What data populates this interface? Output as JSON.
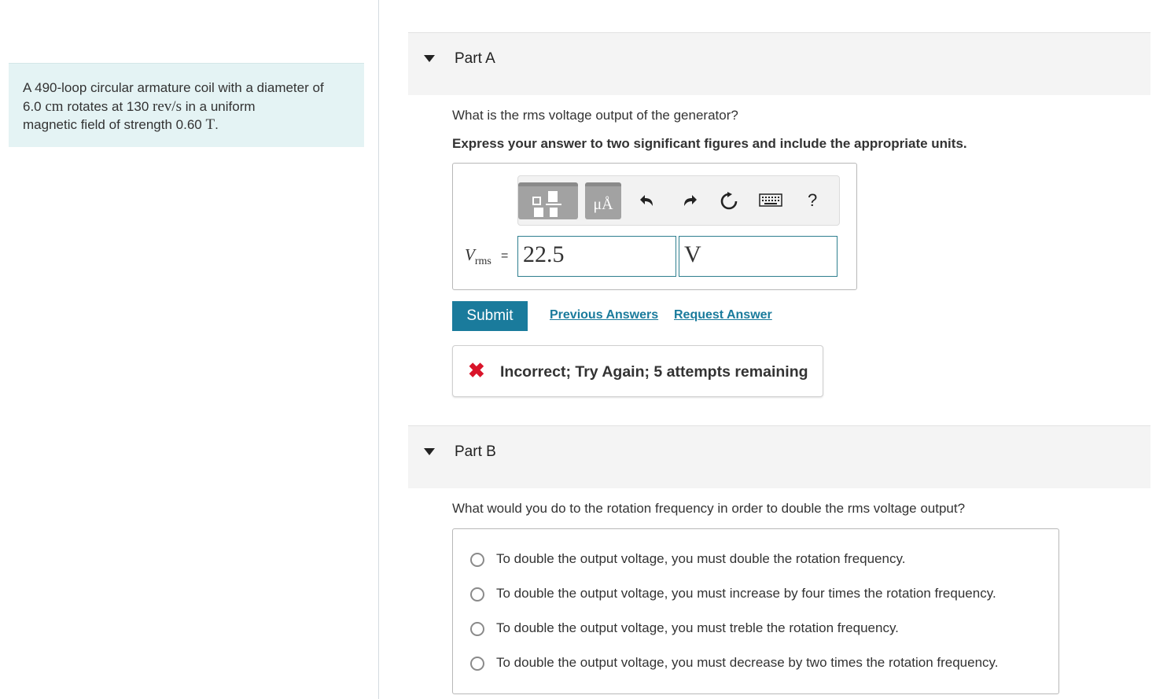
{
  "problem": {
    "text_1": "A 490-loop circular armature coil with a diameter of",
    "value_1": "6.0",
    "unit_1": "cm",
    "text_2": "rotates at 130",
    "unit_2": "rev/s",
    "text_3": "in a uniform",
    "text_4": "magnetic field of strength 0.60",
    "unit_3": "T",
    "text_5": "."
  },
  "part_a": {
    "title": "Part A",
    "question": "What is the rms voltage output of the generator?",
    "instruction": "Express your answer to two significant figures and include the appropriate units.",
    "toolbar": {
      "units_button_label": "μÅ",
      "help_label": "?",
      "icons": [
        "templates-icon",
        "units-icon",
        "undo-icon",
        "redo-icon",
        "reset-icon",
        "keyboard-icon",
        "help-icon"
      ]
    },
    "variable": "V",
    "variable_sub": "rms",
    "equals": "=",
    "value_input": "22.5",
    "units_input": "V",
    "submit_label": "Submit",
    "previous_answers_label": "Previous Answers",
    "request_answer_label": "Request Answer",
    "feedback": {
      "icon": "x-icon",
      "message": "Incorrect; Try Again; 5 attempts remaining"
    }
  },
  "part_b": {
    "title": "Part B",
    "question": "What would you do to the rotation frequency in order to double the rms voltage output?",
    "options": [
      "To double the output voltage, you must double the rotation frequency.",
      "To double the output voltage, you must increase by four times the rotation frequency.",
      "To double the output voltage, you must treble the rotation frequency.",
      "To double the output voltage, you must decrease by two times the rotation frequency."
    ]
  },
  "colors": {
    "accent": "#1a7b9c",
    "problem_bg": "#e4f3f4",
    "error": "#d9142a",
    "part_header_bg": "#f4f4f4"
  }
}
